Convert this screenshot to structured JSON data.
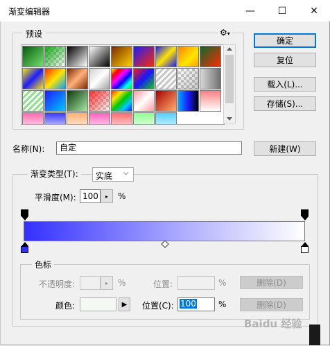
{
  "window": {
    "title": "渐变编辑器",
    "controls": {
      "minimize": "—",
      "maximize": "☐",
      "close": "✕"
    }
  },
  "presets": {
    "legend": "预设",
    "gear_glyph": "⚙",
    "swatches": [
      "linear-gradient(135deg,#0a5a0a,#6fe06f)",
      "checker:linear-gradient(135deg,rgba(0,160,0,0.9),rgba(0,160,0,0))",
      "linear-gradient(135deg,#000,#fff)",
      "linear-gradient(135deg,#fff,#000)",
      "linear-gradient(135deg,#7a2a00,#ffd200)",
      "linear-gradient(135deg,#1c1cff,#ff2a00)",
      "linear-gradient(135deg,#1c1cff,#ffe400 50%,#1c1cff)",
      "linear-gradient(135deg,#ff8000,#ffe600 60%,#ffa000)",
      "linear-gradient(135deg,#0a6a2a,#ff2a00)",
      "linear-gradient(135deg,#ffe600,#1c1cff 50%,#ffe600)",
      "linear-gradient(135deg,#ff2a00,#ffe600 50%,#00a0ff)",
      "linear-gradient(135deg,#7a2a00,#ffb07a 50%,#7a2a00)",
      "linear-gradient(135deg,#d0d0d0,#fff 50%,#a0a0a0)",
      "linear-gradient(135deg,#ff0,#f00,#f0f,#00f,#0ff,#0f0)",
      "checker:linear-gradient(135deg,rgba(255,0,0,0.9),rgba(0,0,255,0.9),rgba(0,200,0,0.9))",
      "repeating-linear-gradient(135deg,#c8c8c8 0 3px,#fff 3px 6px)",
      "checker:linear-gradient(135deg,rgba(0,0,0,0),rgba(0,0,0,0.2))",
      "linear-gradient(to right,#d8d8d8,#707070)",
      "repeating-linear-gradient(135deg,#8fe08f 0 3px,#fff 3px 6px)",
      "linear-gradient(135deg,#1c1cff,#00c8ff)",
      "linear-gradient(135deg,#0a3a0a,#a8e8a8)",
      "checker:linear-gradient(135deg,rgba(255,0,0,0.8),rgba(255,255,0,0))",
      "linear-gradient(135deg,#ff2a00,#ffe600,#00c800,#00c8ff,#1c1cff)",
      "linear-gradient(135deg,#ff9aa0,#fff 50%,#ff9aa0)",
      "linear-gradient(135deg,#a80000,#ffb070)",
      "linear-gradient(to right,#00a8ff,#1c1cff,#000)",
      "linear-gradient(to bottom,#ff8080,#fff)",
      "linear-gradient(to bottom,#ff6ab0,#fff)",
      "linear-gradient(to bottom,#3a3aff,#fff)",
      "linear-gradient(to bottom,#ffb070,#fff)",
      "linear-gradient(to bottom,#ff60c0,#fff)",
      "linear-gradient(to bottom,#ff6a6a,#fff)",
      "linear-gradient(to bottom,#90ff90,#fff)",
      "linear-gradient(to bottom,#50d0ff,#fff)"
    ]
  },
  "buttons": {
    "ok": "确定",
    "reset": "复位",
    "load": "载入(L)...",
    "save": "存储(S)...",
    "new": "新建(W)",
    "delete_opacity": "删除(D)",
    "delete_color": "删除(D)"
  },
  "name": {
    "label": "名称(N):",
    "value": "自定"
  },
  "gradient": {
    "type_label": "渐变类型(T):",
    "type_value": "实底",
    "smoothness_label": "平滑度(M):",
    "smoothness_value": "100",
    "smoothness_unit": "%",
    "colors": {
      "start": "#3330ff",
      "mid": "#b5b4ff",
      "end": "#ffffff"
    },
    "opacity_stops": [
      {
        "position": 0,
        "color": "#000000"
      },
      {
        "position": 100,
        "color": "#000000"
      }
    ],
    "color_stops": [
      {
        "position": 0,
        "color": "#3330ff",
        "selected": true
      },
      {
        "position": 100,
        "color": "#ffffff",
        "selected": false
      }
    ],
    "midpoint": 50
  },
  "stops": {
    "legend": "色标",
    "opacity_label": "不透明度:",
    "opacity_value": "",
    "opacity_unit": "%",
    "opacity_position_label": "位置:",
    "opacity_position_value": "",
    "opacity_position_unit": "%",
    "color_label": "颜色:",
    "color_swatch": "#f4f9f4",
    "color_position_label": "位置(C):",
    "color_position_value": "100",
    "color_position_unit": "%"
  },
  "watermark": "Baidu 经验",
  "colors": {
    "accent": "#0078d7"
  }
}
